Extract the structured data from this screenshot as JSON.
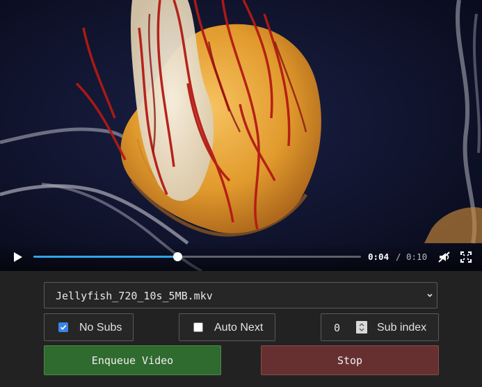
{
  "player": {
    "current_time": "0:04",
    "time_separator": "/",
    "duration": "0:10",
    "progress_fraction": 0.44,
    "muted": true,
    "accent_color": "#2ea7e8",
    "icons": {
      "play": "play-icon",
      "mute": "volume-muted-icon",
      "fullscreen": "fullscreen-icon"
    }
  },
  "file_select": {
    "selected": "Jellyfish_720_10s_5MB.mkv"
  },
  "options": {
    "no_subs": {
      "label": "No Subs",
      "checked": true
    },
    "auto_next": {
      "label": "Auto Next",
      "checked": false
    },
    "sub_index": {
      "label": "Sub index",
      "value": "0"
    }
  },
  "buttons": {
    "enqueue": {
      "label": "Enqueue Video",
      "color": "#2f6a2f"
    },
    "stop": {
      "label": "Stop",
      "color": "#663030"
    }
  }
}
